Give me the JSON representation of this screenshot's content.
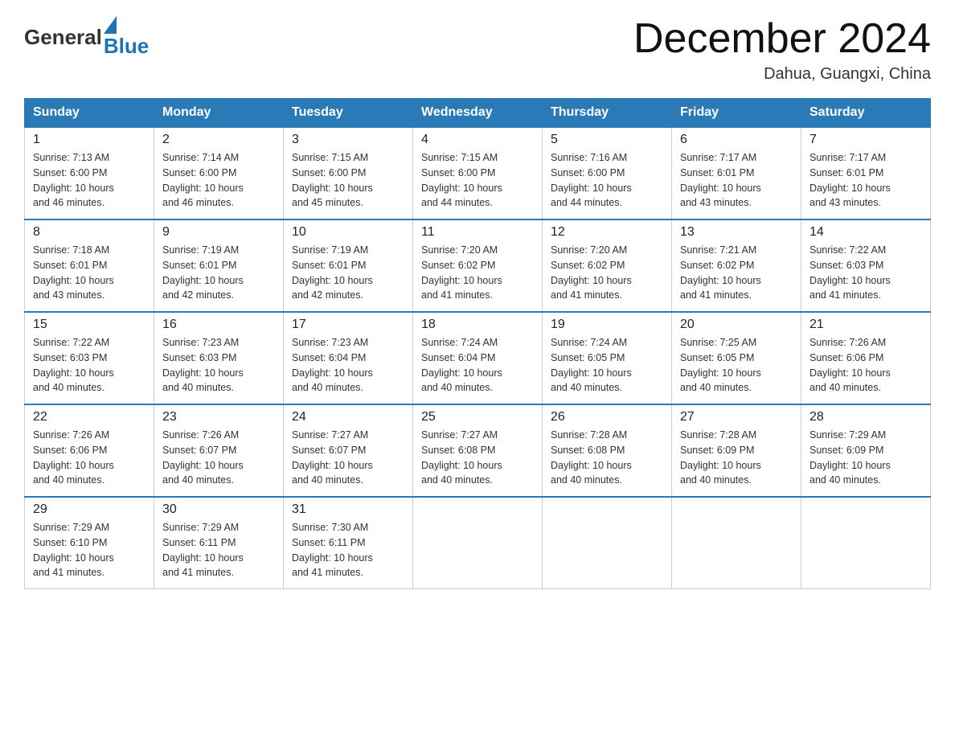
{
  "header": {
    "logo": {
      "general": "General",
      "blue": "Blue"
    },
    "title": "December 2024",
    "location": "Dahua, Guangxi, China"
  },
  "weekdays": [
    "Sunday",
    "Monday",
    "Tuesday",
    "Wednesday",
    "Thursday",
    "Friday",
    "Saturday"
  ],
  "weeks": [
    [
      {
        "day": "1",
        "sunrise": "7:13 AM",
        "sunset": "6:00 PM",
        "daylight": "10 hours and 46 minutes."
      },
      {
        "day": "2",
        "sunrise": "7:14 AM",
        "sunset": "6:00 PM",
        "daylight": "10 hours and 46 minutes."
      },
      {
        "day": "3",
        "sunrise": "7:15 AM",
        "sunset": "6:00 PM",
        "daylight": "10 hours and 45 minutes."
      },
      {
        "day": "4",
        "sunrise": "7:15 AM",
        "sunset": "6:00 PM",
        "daylight": "10 hours and 44 minutes."
      },
      {
        "day": "5",
        "sunrise": "7:16 AM",
        "sunset": "6:00 PM",
        "daylight": "10 hours and 44 minutes."
      },
      {
        "day": "6",
        "sunrise": "7:17 AM",
        "sunset": "6:01 PM",
        "daylight": "10 hours and 43 minutes."
      },
      {
        "day": "7",
        "sunrise": "7:17 AM",
        "sunset": "6:01 PM",
        "daylight": "10 hours and 43 minutes."
      }
    ],
    [
      {
        "day": "8",
        "sunrise": "7:18 AM",
        "sunset": "6:01 PM",
        "daylight": "10 hours and 43 minutes."
      },
      {
        "day": "9",
        "sunrise": "7:19 AM",
        "sunset": "6:01 PM",
        "daylight": "10 hours and 42 minutes."
      },
      {
        "day": "10",
        "sunrise": "7:19 AM",
        "sunset": "6:01 PM",
        "daylight": "10 hours and 42 minutes."
      },
      {
        "day": "11",
        "sunrise": "7:20 AM",
        "sunset": "6:02 PM",
        "daylight": "10 hours and 41 minutes."
      },
      {
        "day": "12",
        "sunrise": "7:20 AM",
        "sunset": "6:02 PM",
        "daylight": "10 hours and 41 minutes."
      },
      {
        "day": "13",
        "sunrise": "7:21 AM",
        "sunset": "6:02 PM",
        "daylight": "10 hours and 41 minutes."
      },
      {
        "day": "14",
        "sunrise": "7:22 AM",
        "sunset": "6:03 PM",
        "daylight": "10 hours and 41 minutes."
      }
    ],
    [
      {
        "day": "15",
        "sunrise": "7:22 AM",
        "sunset": "6:03 PM",
        "daylight": "10 hours and 40 minutes."
      },
      {
        "day": "16",
        "sunrise": "7:23 AM",
        "sunset": "6:03 PM",
        "daylight": "10 hours and 40 minutes."
      },
      {
        "day": "17",
        "sunrise": "7:23 AM",
        "sunset": "6:04 PM",
        "daylight": "10 hours and 40 minutes."
      },
      {
        "day": "18",
        "sunrise": "7:24 AM",
        "sunset": "6:04 PM",
        "daylight": "10 hours and 40 minutes."
      },
      {
        "day": "19",
        "sunrise": "7:24 AM",
        "sunset": "6:05 PM",
        "daylight": "10 hours and 40 minutes."
      },
      {
        "day": "20",
        "sunrise": "7:25 AM",
        "sunset": "6:05 PM",
        "daylight": "10 hours and 40 minutes."
      },
      {
        "day": "21",
        "sunrise": "7:26 AM",
        "sunset": "6:06 PM",
        "daylight": "10 hours and 40 minutes."
      }
    ],
    [
      {
        "day": "22",
        "sunrise": "7:26 AM",
        "sunset": "6:06 PM",
        "daylight": "10 hours and 40 minutes."
      },
      {
        "day": "23",
        "sunrise": "7:26 AM",
        "sunset": "6:07 PM",
        "daylight": "10 hours and 40 minutes."
      },
      {
        "day": "24",
        "sunrise": "7:27 AM",
        "sunset": "6:07 PM",
        "daylight": "10 hours and 40 minutes."
      },
      {
        "day": "25",
        "sunrise": "7:27 AM",
        "sunset": "6:08 PM",
        "daylight": "10 hours and 40 minutes."
      },
      {
        "day": "26",
        "sunrise": "7:28 AM",
        "sunset": "6:08 PM",
        "daylight": "10 hours and 40 minutes."
      },
      {
        "day": "27",
        "sunrise": "7:28 AM",
        "sunset": "6:09 PM",
        "daylight": "10 hours and 40 minutes."
      },
      {
        "day": "28",
        "sunrise": "7:29 AM",
        "sunset": "6:09 PM",
        "daylight": "10 hours and 40 minutes."
      }
    ],
    [
      {
        "day": "29",
        "sunrise": "7:29 AM",
        "sunset": "6:10 PM",
        "daylight": "10 hours and 41 minutes."
      },
      {
        "day": "30",
        "sunrise": "7:29 AM",
        "sunset": "6:11 PM",
        "daylight": "10 hours and 41 minutes."
      },
      {
        "day": "31",
        "sunrise": "7:30 AM",
        "sunset": "6:11 PM",
        "daylight": "10 hours and 41 minutes."
      },
      null,
      null,
      null,
      null
    ]
  ],
  "labels": {
    "sunrise": "Sunrise:",
    "sunset": "Sunset:",
    "daylight": "Daylight:"
  }
}
